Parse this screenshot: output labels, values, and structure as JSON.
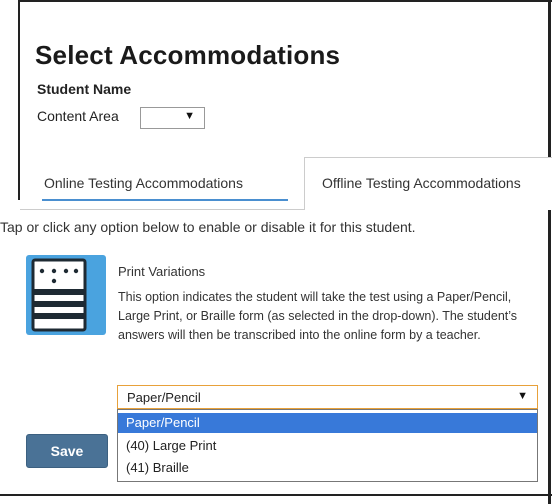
{
  "header": {
    "title": "Select Accommodations",
    "student_name_label": "Student Name",
    "content_area_label": "Content Area",
    "content_area_value": ""
  },
  "tabs": [
    {
      "label": "Online Testing Accommodations",
      "active": false
    },
    {
      "label": "Offline Testing Accommodations",
      "active": true
    }
  ],
  "instructions": "Tap or click any option below to enable or disable it for this student.",
  "option": {
    "icon": "print-variations-icon",
    "title": "Print Variations",
    "description": "This option indicates the student will take the test using a Paper/Pencil, Large Print, or Braille form (as selected in the drop-down). The student’s answers will then be transcribed into the online form by a teacher.",
    "selected_value": "Paper/Pencil",
    "options": [
      "Paper/Pencil",
      "(40) Large Print",
      "(41) Braille"
    ]
  },
  "save_label": "Save",
  "colors": {
    "tab_underline": "#4a8fd0",
    "icon_bg": "#4aa3df",
    "select_focus_border": "#e8a13a",
    "dropdown_highlight": "#3879d9",
    "save_button": "#4a7296"
  }
}
